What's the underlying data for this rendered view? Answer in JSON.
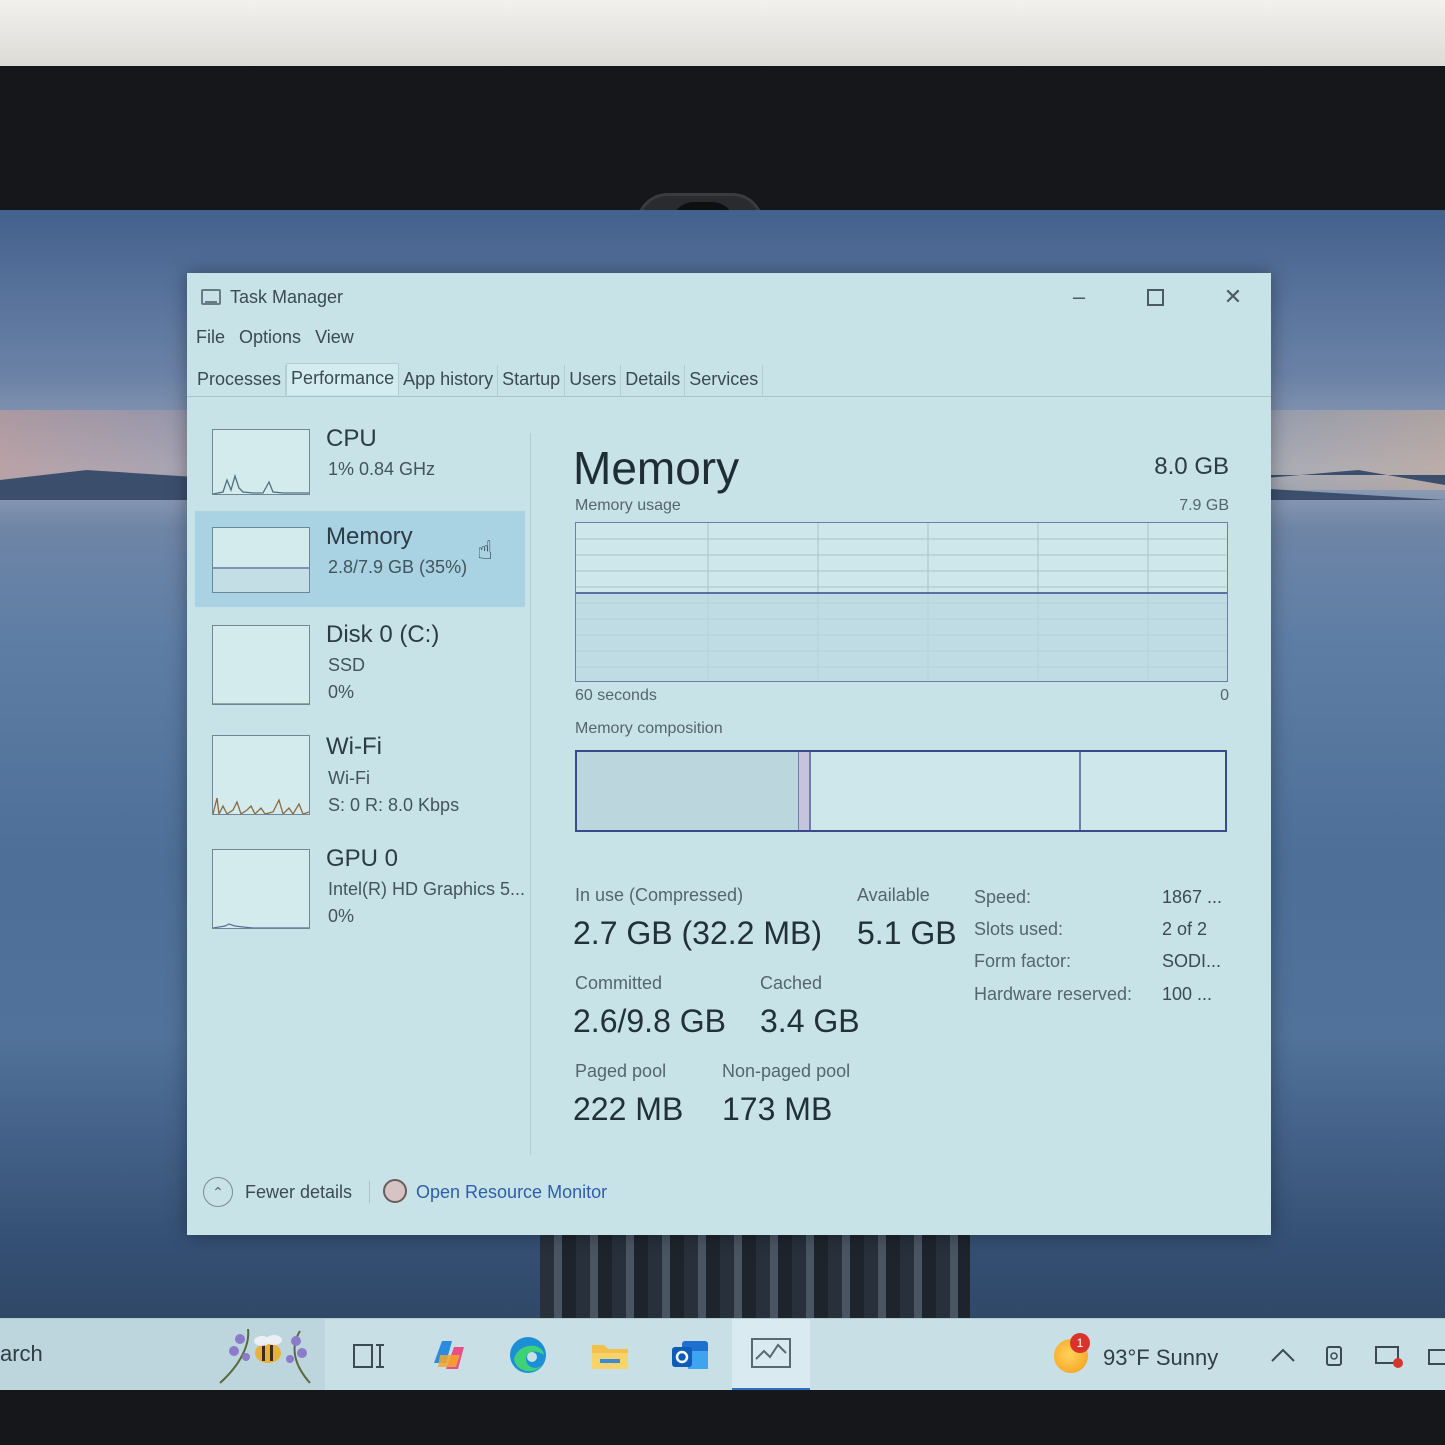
{
  "window": {
    "title": "Task Manager",
    "menu": [
      "File",
      "Options",
      "View"
    ],
    "tabs": [
      "Processes",
      "Performance",
      "App history",
      "Startup",
      "Users",
      "Details",
      "Services"
    ],
    "active_tab": "Performance"
  },
  "resources": [
    {
      "name": "CPU",
      "line1": "1%  0.84 GHz",
      "line2": ""
    },
    {
      "name": "Memory",
      "line1": "2.8/7.9 GB (35%)",
      "line2": "",
      "selected": true
    },
    {
      "name": "Disk 0 (C:)",
      "line1": "SSD",
      "line2": "0%"
    },
    {
      "name": "Wi-Fi",
      "line1": "Wi-Fi",
      "line2": "S: 0  R: 8.0 Kbps"
    },
    {
      "name": "GPU 0",
      "line1": "Intel(R) HD Graphics 5...",
      "line2": "0%"
    }
  ],
  "memory": {
    "title": "Memory",
    "total": "8.0 GB",
    "usage_label": "Memory usage",
    "usage_max": "7.9 GB",
    "axis_left": "60 seconds",
    "axis_right": "0",
    "composition_label": "Memory composition",
    "stats": {
      "in_use_label": "In use (Compressed)",
      "in_use_value": "2.7 GB (32.2 MB)",
      "available_label": "Available",
      "available_value": "5.1 GB",
      "committed_label": "Committed",
      "committed_value": "2.6/9.8 GB",
      "cached_label": "Cached",
      "cached_value": "3.4 GB",
      "paged_label": "Paged pool",
      "paged_value": "222 MB",
      "nonpaged_label": "Non-paged pool",
      "nonpaged_value": "173 MB"
    },
    "properties": [
      {
        "key": "Speed:",
        "value": "1867 ..."
      },
      {
        "key": "Slots used:",
        "value": "2 of 2"
      },
      {
        "key": "Form factor:",
        "value": "SODI..."
      },
      {
        "key": "Hardware reserved:",
        "value": "100 ..."
      }
    ],
    "usage_fraction": 0.35
  },
  "footer": {
    "fewer_details": "Fewer details",
    "resource_monitor": "Open Resource Monitor"
  },
  "taskbar": {
    "search_text": "arch",
    "weather": "93°F  Sunny",
    "weather_badge": "1"
  },
  "colors": {
    "window_bg": "#c7e3e7",
    "selected_bg": "#a9d2e2",
    "graph_line": "#3a4a8c",
    "link": "#2d5fa8"
  }
}
